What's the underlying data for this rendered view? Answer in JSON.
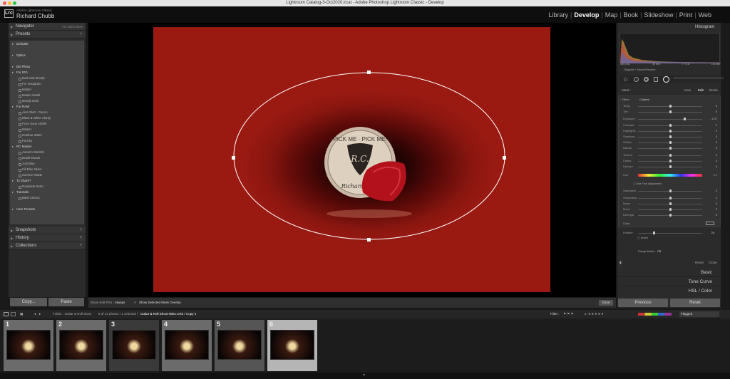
{
  "window_title": "Lightroom Catalog-3-Oct2020.lrcat - Adobe Photoshop Lightroom Classic - Develop",
  "identity": {
    "top": "Adobe Lightroom Classic",
    "name": "Richard Chubb",
    "logo": "Lrc"
  },
  "modules": [
    "Library",
    "Develop",
    "Map",
    "Book",
    "Slideshow",
    "Print",
    "Web"
  ],
  "active_module": "Develop",
  "left": {
    "navigator": "Navigator",
    "nav_zoom": "FIT  100%  200%",
    "presets": "Presets",
    "preset_items": [
      {
        "t": "f",
        "label": "Defaults"
      },
      {
        "t": "g"
      },
      {
        "t": "f",
        "label": "Optics"
      },
      {
        "t": "g"
      },
      {
        "t": "f",
        "label": "DE Photo"
      },
      {
        "t": "f",
        "label": "For IPG"
      },
      {
        "t": "i",
        "label": "Dark and Moody"
      },
      {
        "t": "i",
        "label": "For Instagram"
      },
      {
        "t": "i",
        "label": "Master"
      },
      {
        "t": "i",
        "label": "Master Detail"
      },
      {
        "t": "i",
        "label": "Moody Dark"
      },
      {
        "t": "f",
        "label": "For RAW"
      },
      {
        "t": "i",
        "label": "Auto Start - Canon"
      },
      {
        "t": "i",
        "label": "Black & White Clarity"
      },
      {
        "t": "i",
        "label": "From Sony A6300"
      },
      {
        "t": "i",
        "label": "Master"
      },
      {
        "t": "i",
        "label": "Outdoor Warm"
      },
      {
        "t": "i",
        "label": "Punchy"
      },
      {
        "t": "f",
        "label": "RC Master"
      },
      {
        "t": "i",
        "label": "Autumn Warmth"
      },
      {
        "t": "i",
        "label": "Detail Moods"
      },
      {
        "t": "i",
        "label": "Just Blue"
      },
      {
        "t": "i",
        "label": "Kill Blue Skies"
      },
      {
        "t": "i",
        "label": "Summer Matte"
      },
      {
        "t": "f",
        "label": "To Share?"
      },
      {
        "t": "i",
        "label": "Roadside Retro"
      },
      {
        "t": "f",
        "label": "Tutorials"
      },
      {
        "t": "i",
        "label": "B&W Classic"
      },
      {
        "t": "g"
      },
      {
        "t": "f",
        "label": "User Presets"
      }
    ],
    "snapshots": "Snapshots",
    "history": "History",
    "collections": "Collections",
    "copy": "Copy...",
    "paste": "Paste"
  },
  "photo_text": {
    "line1": "PICK ME · PICK ME!",
    "mono": "R.C.",
    "line2": "Richard C"
  },
  "toolbar": {
    "show_edit_pins": "Show Edit Pins :",
    "pins_value": "Always",
    "overlay": "Show Selected Mask Overlay",
    "done": "Done"
  },
  "right": {
    "histogram": "Histogram",
    "histo_info": [
      "100 ISO",
      "35 mm",
      "f / 5.6",
      "1/4 sec"
    ],
    "preview": "Original + Smart Preview",
    "mask_label": "Mask :",
    "mask_tabs": [
      "New",
      "Edit",
      "Brush"
    ],
    "effect_label": "Effect :",
    "effect_value": "Custom",
    "sliders": [
      {
        "label": "Temp",
        "pos": 0.5,
        "val": "0"
      },
      {
        "label": "Tint",
        "pos": 0.5,
        "val": "0"
      },
      {
        "label": "Exposure",
        "pos": 0.72,
        "val": "- 1.07"
      },
      {
        "label": "Contrast",
        "pos": 0.5,
        "val": "0"
      },
      {
        "label": "Highlights",
        "pos": 0.5,
        "val": "0"
      },
      {
        "label": "Shadows",
        "pos": 0.5,
        "val": "0"
      },
      {
        "label": "Whites",
        "pos": 0.5,
        "val": "0"
      },
      {
        "label": "Blacks",
        "pos": 0.5,
        "val": "0"
      },
      {
        "label": "Texture",
        "pos": 0.5,
        "val": "0"
      },
      {
        "label": "Clarity",
        "pos": 0.5,
        "val": "0"
      },
      {
        "label": "Dehaze",
        "pos": 0.5,
        "val": "0"
      }
    ],
    "hue_label": "Hue",
    "hue_val": "0.0",
    "fine_adj": "Use Fine Adjustment",
    "sliders2": [
      {
        "label": "Saturation",
        "pos": 0.5,
        "val": "0"
      },
      {
        "label": "Sharpness",
        "pos": 0.5,
        "val": "0"
      },
      {
        "label": "Noise",
        "pos": 0.5,
        "val": "0"
      },
      {
        "label": "Moiré",
        "pos": 0.5,
        "val": "0"
      },
      {
        "label": "Defringe",
        "pos": 0.5,
        "val": "0"
      }
    ],
    "color_label": "Color",
    "feather_label": "Feather",
    "feather_val": "24",
    "invert": "Invert",
    "range_mask": "Range Mask :",
    "range_val": "Off",
    "reset": "Reset",
    "close": "Close",
    "panels": [
      "Basic",
      "Tone Curve",
      "HSL / Color"
    ],
    "previous": "Previous",
    "reset_btn": "Reset"
  },
  "filmbar": {
    "folder": "Folder : Guitar & Roll shots",
    "count": "6 of 41 photos / 1 selected /",
    "file": "Guitar & Roll Shoot-0001.CR2 / Copy 1",
    "filter": "Filter :",
    "flagged": "Flagged"
  },
  "thumbs": [
    "1",
    "2",
    "3",
    "4",
    "5",
    "6"
  ]
}
